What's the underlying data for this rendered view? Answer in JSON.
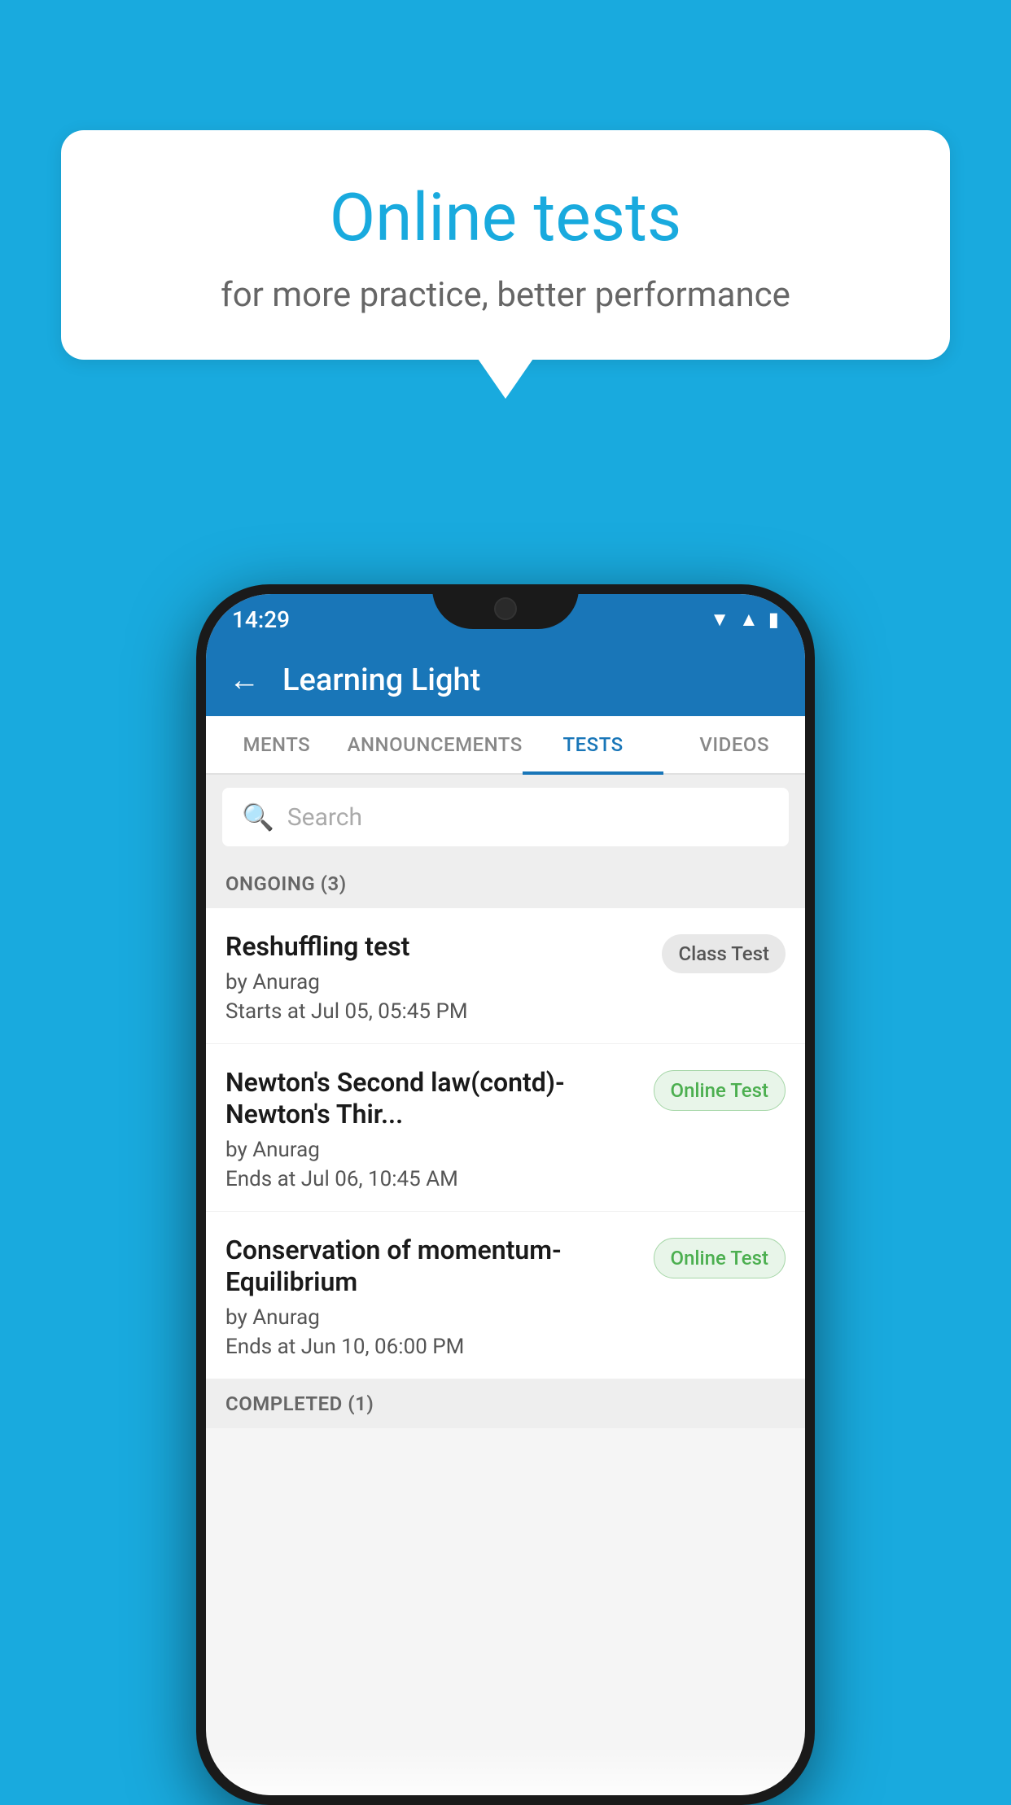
{
  "background_color": "#19aade",
  "speech_bubble": {
    "title": "Online tests",
    "subtitle": "for more practice, better performance"
  },
  "phone": {
    "status_bar": {
      "time": "14:29",
      "icons": [
        "wifi",
        "signal",
        "battery"
      ]
    },
    "app_bar": {
      "back_icon": "←",
      "title": "Learning Light"
    },
    "tabs": [
      {
        "label": "MENTS",
        "active": false
      },
      {
        "label": "ANNOUNCEMENTS",
        "active": false
      },
      {
        "label": "TESTS",
        "active": true
      },
      {
        "label": "VIDEOS",
        "active": false
      }
    ],
    "search": {
      "placeholder": "Search",
      "icon": "🔍"
    },
    "sections": [
      {
        "header": "ONGOING (3)",
        "tests": [
          {
            "title": "Reshuffling test",
            "author": "by Anurag",
            "time_label": "Starts at",
            "time": "Jul 05, 05:45 PM",
            "badge": "Class Test",
            "badge_type": "class"
          },
          {
            "title": "Newton's Second law(contd)-Newton's Thir...",
            "author": "by Anurag",
            "time_label": "Ends at",
            "time": "Jul 06, 10:45 AM",
            "badge": "Online Test",
            "badge_type": "online"
          },
          {
            "title": "Conservation of momentum-Equilibrium",
            "author": "by Anurag",
            "time_label": "Ends at",
            "time": "Jun 10, 06:00 PM",
            "badge": "Online Test",
            "badge_type": "online"
          }
        ]
      },
      {
        "header": "COMPLETED (1)",
        "tests": []
      }
    ]
  }
}
